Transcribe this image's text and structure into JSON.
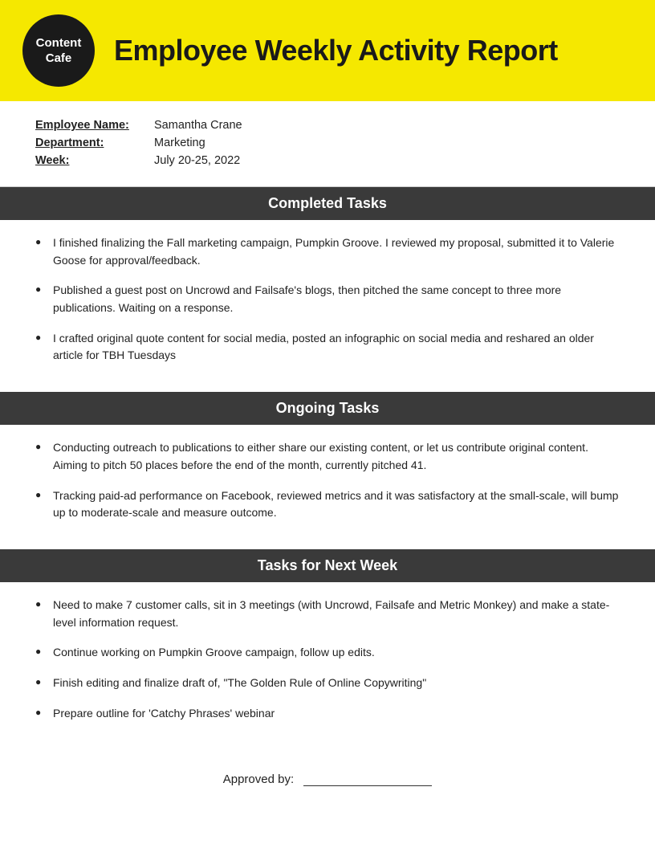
{
  "header": {
    "logo_line1": "Content",
    "logo_line2": "Cafe",
    "title": "Employee Weekly Activity Report"
  },
  "info": {
    "employee_label": "Employee Name:",
    "employee_value": "Samantha Crane",
    "department_label": "Department:",
    "department_value": "Marketing",
    "week_label": "Week:",
    "week_value": "July 20-25, 2022"
  },
  "completed_tasks": {
    "heading": "Completed Tasks",
    "items": [
      "I finished finalizing the Fall marketing campaign, Pumpkin Groove. I reviewed my proposal, submitted it to Valerie Goose for approval/feedback.",
      "Published a guest post on Uncrowd and Failsafe's blogs, then pitched the same concept to three more publications. Waiting on a response.",
      "I crafted original quote content for social media, posted an infographic on social media and reshared an older article for TBH Tuesdays"
    ]
  },
  "ongoing_tasks": {
    "heading": "Ongoing Tasks",
    "items": [
      "Conducting outreach to publications to either share our existing content, or let us contribute original content. Aiming to pitch 50 places before the end of the month, currently pitched 41.",
      "Tracking paid-ad performance on Facebook, reviewed metrics and it was satisfactory at the small-scale, will bump up to moderate-scale and measure outcome."
    ]
  },
  "next_week_tasks": {
    "heading": "Tasks for Next Week",
    "items": [
      "Need to make 7 customer calls, sit in 3 meetings (with Uncrowd, Failsafe and Metric Monkey) and make a state-level information request.",
      "Continue working on Pumpkin Groove campaign, follow up edits.",
      "Finish editing and finalize draft of, \"The Golden Rule of Online Copywriting\"",
      "Prepare outline for 'Catchy Phrases' webinar"
    ]
  },
  "approved": {
    "label": "Approved by:"
  }
}
